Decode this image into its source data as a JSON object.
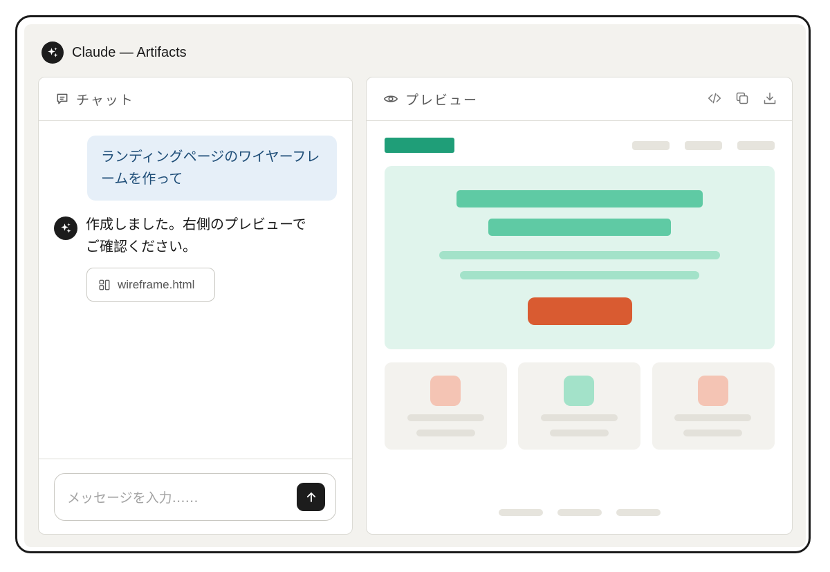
{
  "app": {
    "title": "Claude — Artifacts"
  },
  "chat": {
    "header_label": "チャット",
    "user_message": "ランディングページのワイヤーフレームを作って",
    "assistant_message": "作成しました。右側のプレビューでご確認ください。",
    "attachment": {
      "file_name": "wireframe.html"
    },
    "composer": {
      "placeholder": "メッセージを入力……"
    }
  },
  "preview": {
    "header_label": "プレビュー",
    "tools": [
      "code-icon",
      "copy-icon",
      "download-icon"
    ],
    "wireframe": {
      "colors": {
        "logo": "#1f9e78",
        "hero_background": "#e0f4ec",
        "heading_block": "#5fcaa4",
        "text_block": "#a3e2c9",
        "cta_button": "#d95b31",
        "card_background": "#f3f2ee",
        "card_icon_salmon": "#f4c4b4",
        "card_icon_mint": "#a3e2c9",
        "placeholder_gray": "#e6e4dd"
      },
      "nav_item_count": 3,
      "card_count": 3,
      "footer_link_count": 3
    }
  },
  "colors": {
    "app_background": "#f3f2ee",
    "user_bubble_background": "#e6eff8",
    "user_bubble_text": "#1f4e78",
    "dark": "#1c1c1c"
  }
}
